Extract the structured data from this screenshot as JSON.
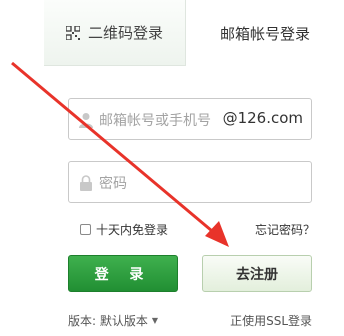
{
  "tabs": {
    "qr_label": "二维码登录",
    "email_label": "邮箱帐号登录"
  },
  "form": {
    "email_placeholder": "邮箱帐号或手机号",
    "email_domain": "@126.com",
    "password_placeholder": "密码",
    "remember_label": "十天内免登录",
    "forgot_label": "忘记密码？"
  },
  "buttons": {
    "login_label": "登 录",
    "register_label": "去注册"
  },
  "footer": {
    "version_label": "版本: 默认版本",
    "ssl_label": "正使用SSL登录"
  },
  "colors": {
    "accent_green": "#2a9e3c",
    "annotation_arrow": "#e8332a"
  },
  "icons": {
    "qr": "qr-code-icon",
    "user": "user-icon",
    "lock": "lock-icon",
    "caret": "chevron-down-icon"
  }
}
